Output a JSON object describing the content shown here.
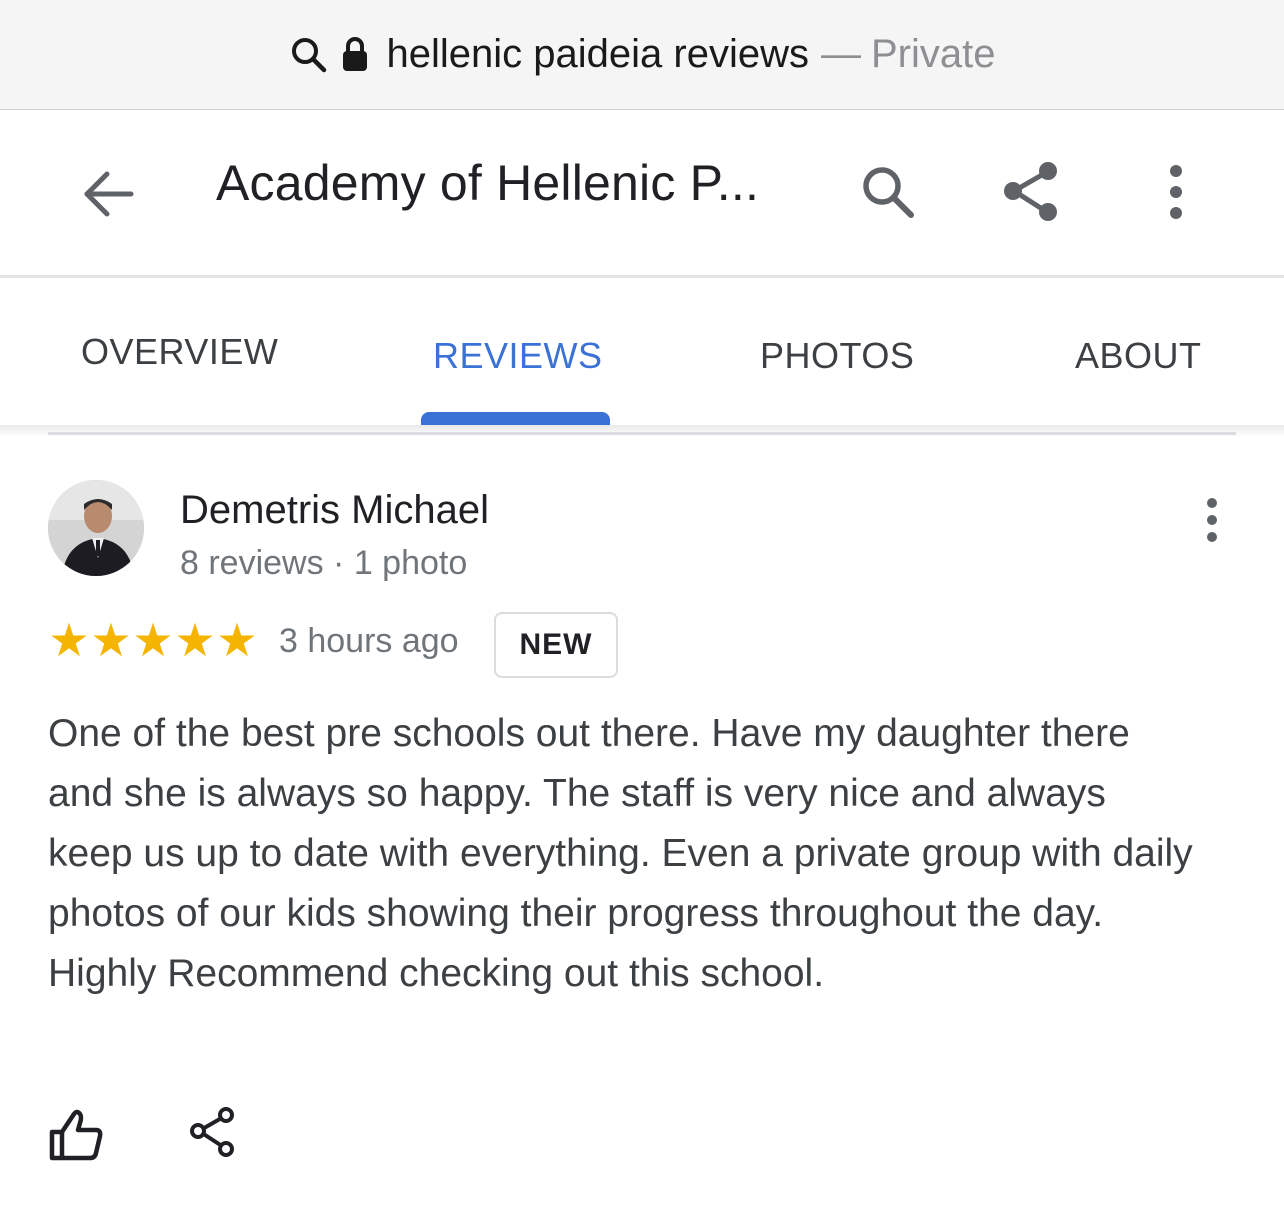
{
  "address_bar": {
    "query": "hellenic paideia reviews",
    "separator": "—",
    "mode": "Private",
    "icons": [
      "search-icon",
      "lock-icon"
    ]
  },
  "header": {
    "title": "Academy of Hellenic P...",
    "icons": [
      "back-arrow-icon",
      "search-icon",
      "share-icon",
      "more-vert-icon"
    ]
  },
  "tabs": {
    "items": [
      {
        "label": "OVERVIEW",
        "active": false
      },
      {
        "label": "REVIEWS",
        "active": true
      },
      {
        "label": "PHOTOS",
        "active": false
      },
      {
        "label": "ABOUT",
        "active": false
      }
    ],
    "active_color": "#3b72d6"
  },
  "review": {
    "author": "Demetris Michael",
    "author_meta": "8 reviews · 1 photo",
    "rating": 5,
    "rating_max": 5,
    "star_color": "#f4b400",
    "time": "3 hours ago",
    "badge": "NEW",
    "text": "One of the best pre schools out there. Have my daughter there and she is always so happy. The staff is very nice and always keep us up to date with everything. Even a private group with daily photos of our kids showing their progress throughout the day. Highly Recommend checking out this school.",
    "actions": [
      "thumbs-up-icon",
      "share-icon"
    ]
  }
}
